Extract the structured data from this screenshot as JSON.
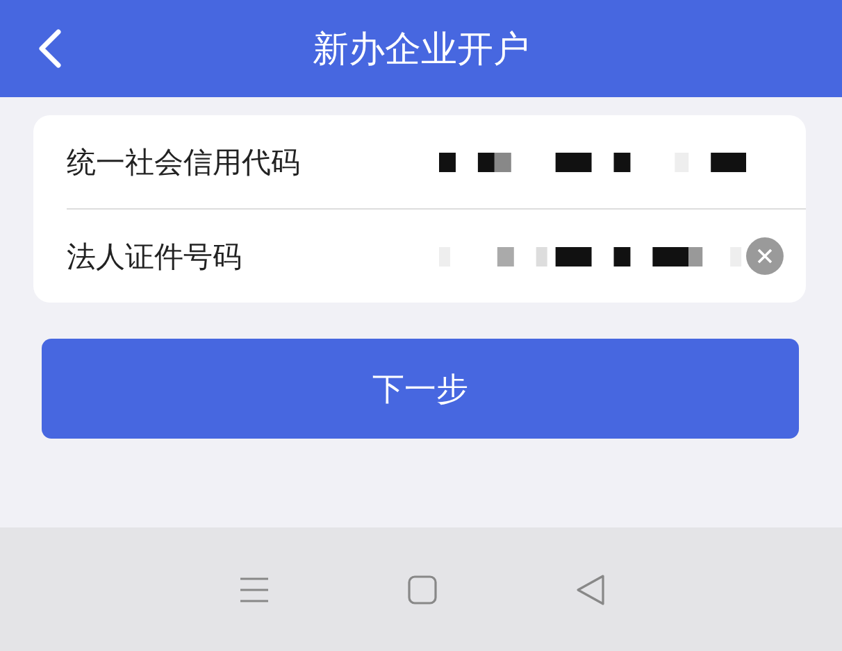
{
  "header": {
    "title": "新办企业开户"
  },
  "form": {
    "rows": [
      {
        "label": "统一社会信用代码",
        "clearable": false
      },
      {
        "label": "法人证件号码",
        "clearable": true
      }
    ]
  },
  "next_button": {
    "label": "下一步"
  }
}
